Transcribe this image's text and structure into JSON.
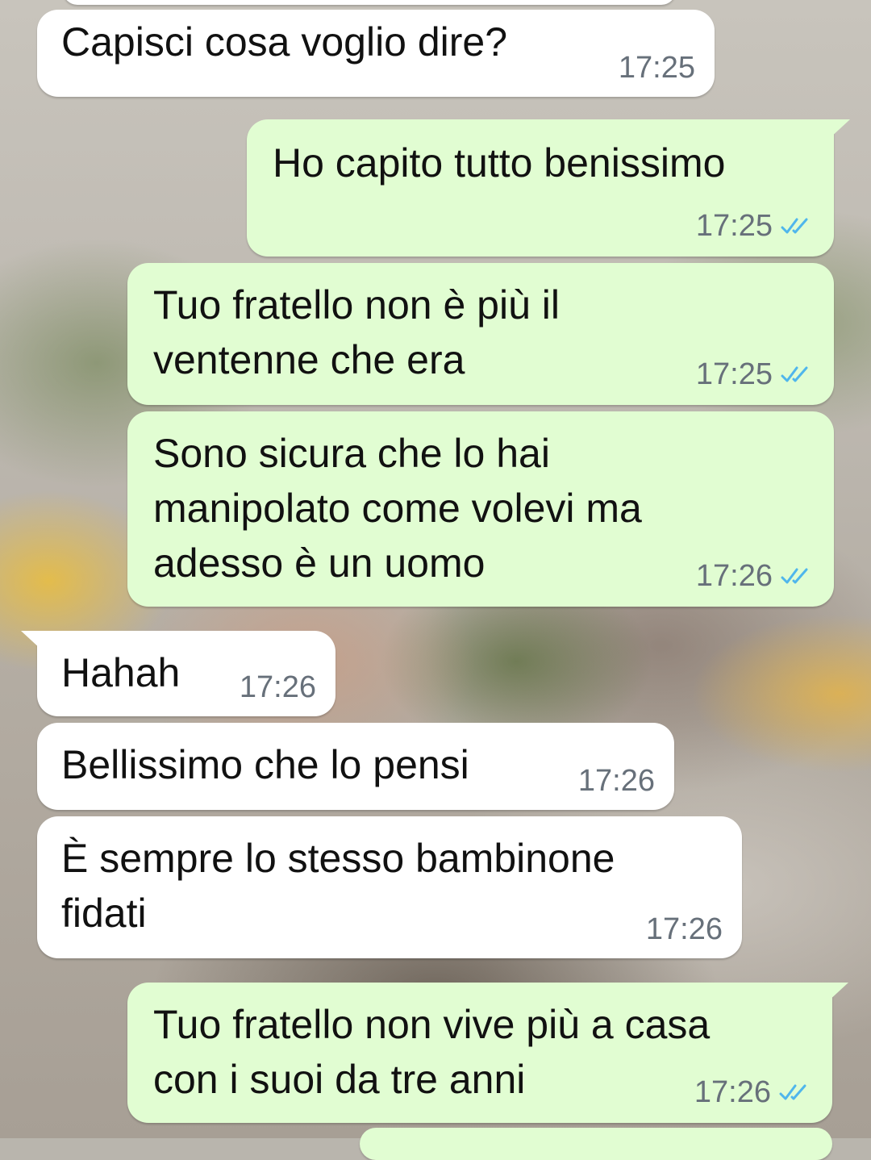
{
  "colors": {
    "incoming_bubble": "#ffffff",
    "outgoing_bubble": "#e1fdd2",
    "timestamp": "#67707a",
    "read_ticks": "#4fb6ec"
  },
  "messages": [
    {
      "direction": "in",
      "text": "Capisci cosa voglio dire?",
      "time": "17:25"
    },
    {
      "direction": "out",
      "text": "Ho capito tutto benissimo",
      "time": "17:25",
      "status": "read-double-check-icon"
    },
    {
      "direction": "out",
      "text": "Tuo fratello non è più il\nventenne che era",
      "time": "17:25",
      "status": "read-double-check-icon"
    },
    {
      "direction": "out",
      "text": "Sono sicura che lo hai\nmanipolato come volevi ma\nadesso è un uomo",
      "time": "17:26",
      "status": "read-double-check-icon"
    },
    {
      "direction": "in",
      "text": "Hahah",
      "time": "17:26"
    },
    {
      "direction": "in",
      "text": "Bellissimo che lo pensi",
      "time": "17:26"
    },
    {
      "direction": "in",
      "text": "È sempre lo stesso bambinone\nfidati",
      "time": "17:26"
    },
    {
      "direction": "out",
      "text": "Tuo fratello non vive più a casa\ncon i suoi da tre anni",
      "time": "17:26",
      "status": "read-double-check-icon"
    }
  ]
}
